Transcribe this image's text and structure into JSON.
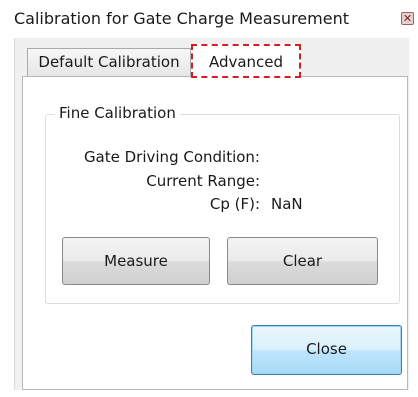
{
  "window": {
    "title": "Calibration for Gate Charge Measurement",
    "close_icon": "close-icon",
    "close_glyph": "✕"
  },
  "tabs": [
    {
      "label": "Default Calibration",
      "selected": false
    },
    {
      "label": "Advanced",
      "selected": true,
      "highlighted": true
    }
  ],
  "fine_calibration": {
    "title": "Fine Calibration",
    "gate_driving_condition_label": "Gate Driving Condition:",
    "current_range_label": "Current Range:",
    "cp_label": "Cp (F):",
    "cp_value": "NaN",
    "measure_label": "Measure",
    "clear_label": "Clear"
  },
  "footer": {
    "close_label": "Close"
  },
  "colors": {
    "highlight_dashed_border": "#d42020",
    "default_button_border": "#3c7fb1"
  }
}
